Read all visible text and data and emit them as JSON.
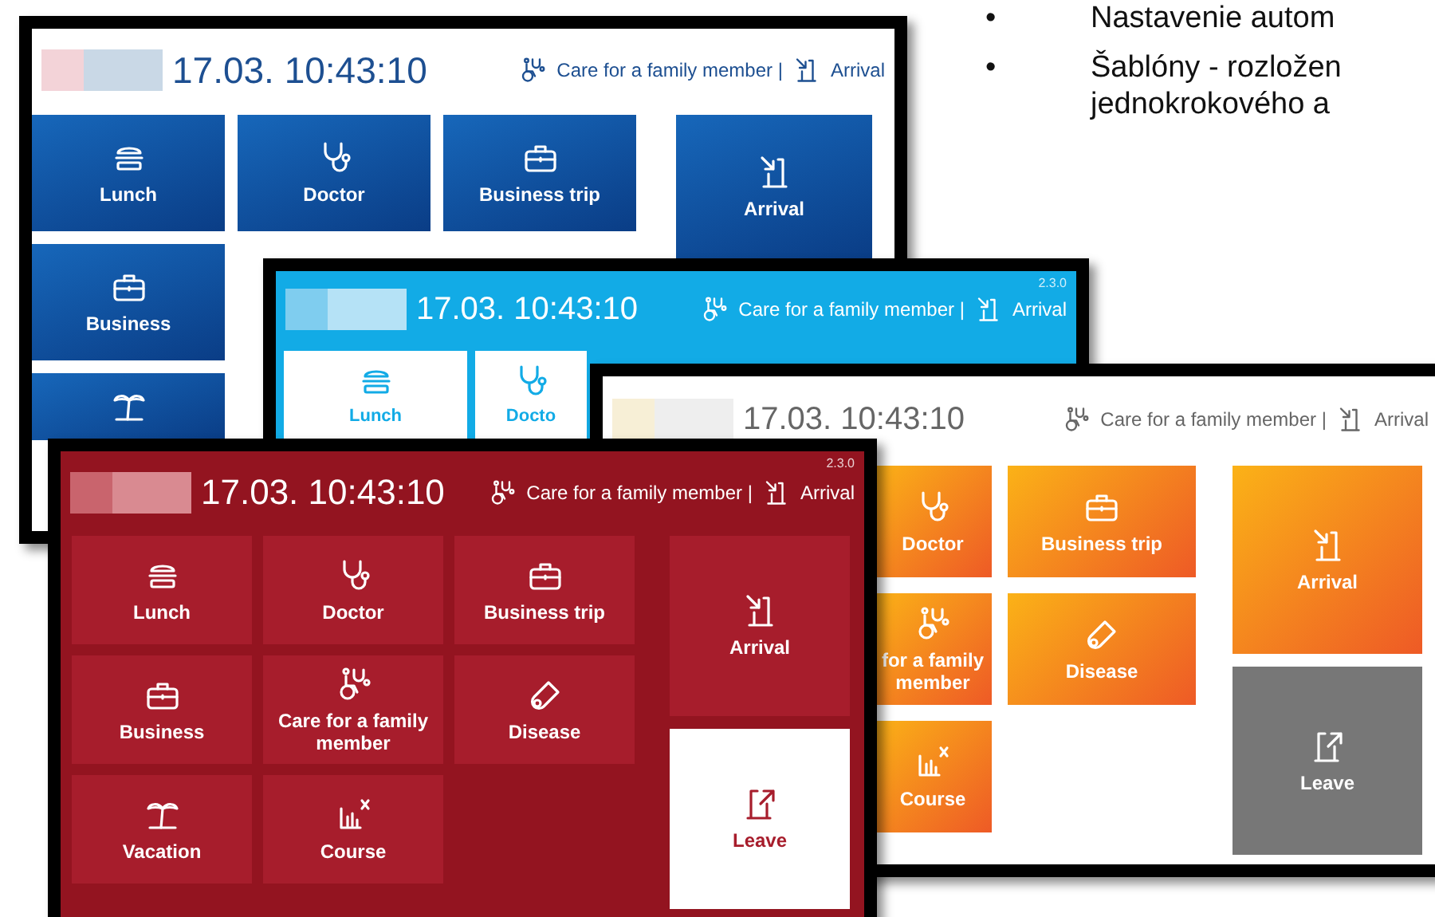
{
  "slide_bullets": [
    {
      "bullet": "•",
      "lines": [
        "Nastavenie autom"
      ]
    },
    {
      "bullet": "•",
      "lines": [
        "Šablóny - rozložen",
        "jednokrokového a"
      ]
    }
  ],
  "screens": [
    {
      "kind": "blue",
      "header": {
        "time": "17.03. 10:43:10",
        "absence": "Care for a family member |",
        "presence": "Arrival"
      },
      "tiles": [
        {
          "kind": "lunch",
          "label": "Lunch"
        },
        {
          "kind": "doctor",
          "label": "Doctor"
        },
        {
          "kind": "trip",
          "label": "Business trip"
        },
        {
          "kind": "trip",
          "label": "Business"
        },
        {
          "kind": "vacation"
        }
      ],
      "actions": [
        {
          "kind": "arrival",
          "label": "Arrival",
          "selected": false
        }
      ]
    },
    {
      "kind": "cyan",
      "header": {
        "time": "17.03. 10:43:10",
        "absence": "Care for a family member |",
        "presence": "Arrival",
        "version": "2.3.0"
      },
      "tiles": [
        {
          "kind": "lunch",
          "label": "Lunch"
        },
        {
          "kind": "doctor",
          "label": "Docto"
        }
      ]
    },
    {
      "kind": "orange",
      "header": {
        "time": "17.03. 10:43:10",
        "absence": "Care for a family member |",
        "presence": "Arrival"
      },
      "tiles": [
        {
          "kind": "doctor",
          "label": "Doctor"
        },
        {
          "kind": "trip",
          "label": "Business trip"
        },
        {
          "kind": "care",
          "label": "for a family member"
        },
        {
          "kind": "disease",
          "label": "Disease"
        },
        {
          "kind": "course",
          "label": "Course"
        }
      ],
      "actions": [
        {
          "kind": "arrival",
          "label": "Arrival",
          "selected": false
        },
        {
          "kind": "leave",
          "label": "Leave",
          "selected": true
        }
      ]
    },
    {
      "kind": "red",
      "header": {
        "time": "17.03. 10:43:10",
        "absence": "Care for a family member |",
        "presence": "Arrival",
        "version": "2.3.0"
      },
      "tiles": [
        {
          "kind": "lunch",
          "label": "Lunch"
        },
        {
          "kind": "doctor",
          "label": "Doctor"
        },
        {
          "kind": "trip",
          "label": "Business trip"
        },
        {
          "kind": "trip",
          "label": "Business"
        },
        {
          "kind": "care",
          "label": "Care for a family member"
        },
        {
          "kind": "disease",
          "label": "Disease"
        },
        {
          "kind": "vacation",
          "label": "Vacation"
        },
        {
          "kind": "course",
          "label": "Course"
        }
      ],
      "actions": [
        {
          "kind": "arrival",
          "label": "Arrival",
          "selected": false
        },
        {
          "kind": "leave",
          "label": "Leave",
          "selected": true
        }
      ]
    }
  ]
}
